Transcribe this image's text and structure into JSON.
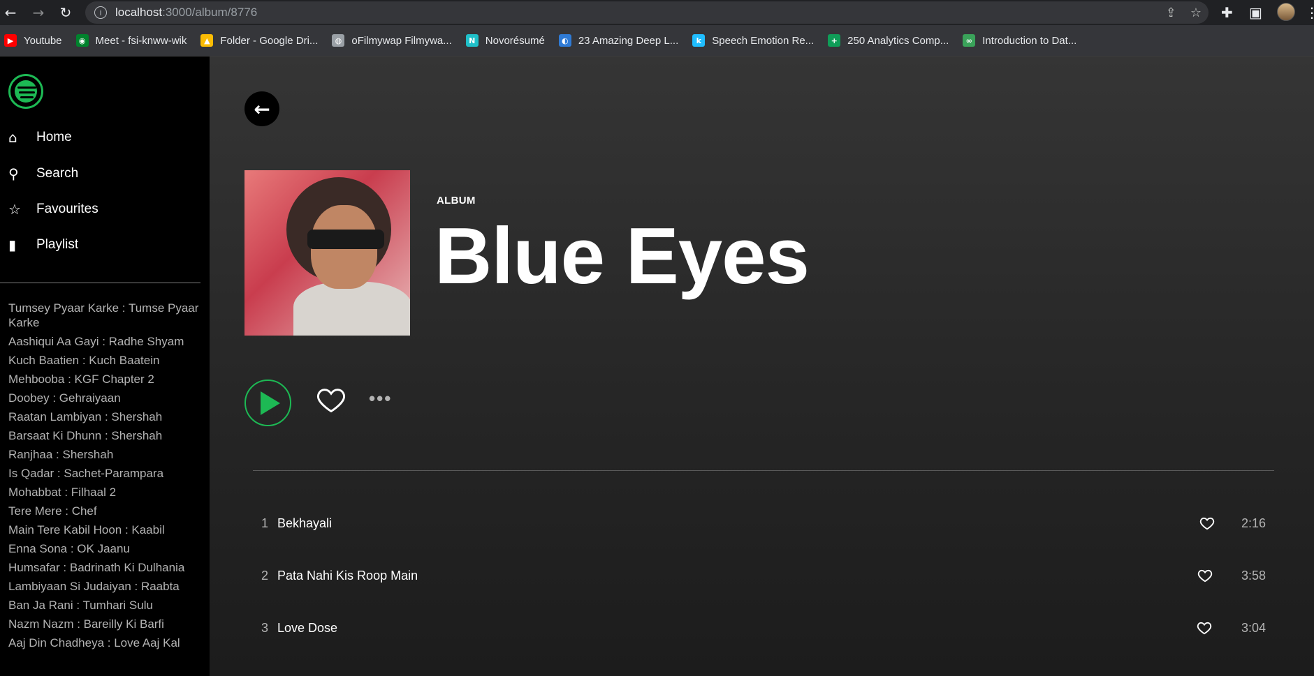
{
  "browser": {
    "url_host": "localhost",
    "url_rest": ":3000/album/8776",
    "bookmarks": [
      {
        "label": "Youtube",
        "icon": "youtube-icon",
        "color": "#ff0000"
      },
      {
        "label": "Meet - fsi-knww-wik",
        "icon": "meet-icon",
        "color": "#00832d"
      },
      {
        "label": "Folder - Google Dri...",
        "icon": "drive-icon",
        "color": "#fbbc04"
      },
      {
        "label": "oFilmywap Filmywa...",
        "icon": "globe-icon",
        "color": "#9aa0a6"
      },
      {
        "label": "Novorésumé",
        "icon": "novoresume-icon",
        "color": "#1fc0c9"
      },
      {
        "label": "23 Amazing Deep L...",
        "icon": "edge-icon",
        "color": "#2f7bd6"
      },
      {
        "label": "Speech Emotion Re...",
        "icon": "kaggle-icon",
        "color": "#20beff"
      },
      {
        "label": "250 Analytics Comp...",
        "icon": "sheets-icon",
        "color": "#0f9d58"
      },
      {
        "label": "Introduction to Dat...",
        "icon": "analytics-icon",
        "color": "#3aa35a"
      }
    ]
  },
  "sidebar": {
    "menu": [
      {
        "label": "Home",
        "icon": "home-icon"
      },
      {
        "label": "Search",
        "icon": "search-icon"
      },
      {
        "label": "Favourites",
        "icon": "star-icon"
      },
      {
        "label": "Playlist",
        "icon": "book-icon"
      }
    ],
    "songs": [
      "Tumsey Pyaar Karke : Tumse Pyaar Karke",
      "Aashiqui Aa Gayi : Radhe Shyam",
      "Kuch Baatien : Kuch Baatein",
      "Mehbooba : KGF Chapter 2",
      "Doobey : Gehraiyaan",
      "Raatan Lambiyan : Shershah",
      "Barsaat Ki Dhunn : Shershah",
      "Ranjhaa : Shershah",
      "Is Qadar : Sachet-Parampara",
      "Mohabbat : Filhaal 2",
      "Tere Mere : Chef",
      "Main Tere Kabil Hoon : Kaabil",
      "Enna Sona : OK Jaanu",
      "Humsafar : Badrinath Ki Dulhania",
      "Lambiyaan Si Judaiyan : Raabta",
      "Ban Ja Rani : Tumhari Sulu",
      "Nazm Nazm : Bareilly Ki Barfi",
      "Aaj Din Chadheya : Love Aaj Kal"
    ]
  },
  "album": {
    "type_label": "ALBUM",
    "title": "Blue Eyes",
    "accent_color": "#1db954",
    "tracks": [
      {
        "num": "1",
        "name": "Bekhayali",
        "duration": "2:16"
      },
      {
        "num": "2",
        "name": "Pata Nahi Kis Roop Main",
        "duration": "3:58"
      },
      {
        "num": "3",
        "name": "Love Dose",
        "duration": "3:04"
      }
    ]
  }
}
